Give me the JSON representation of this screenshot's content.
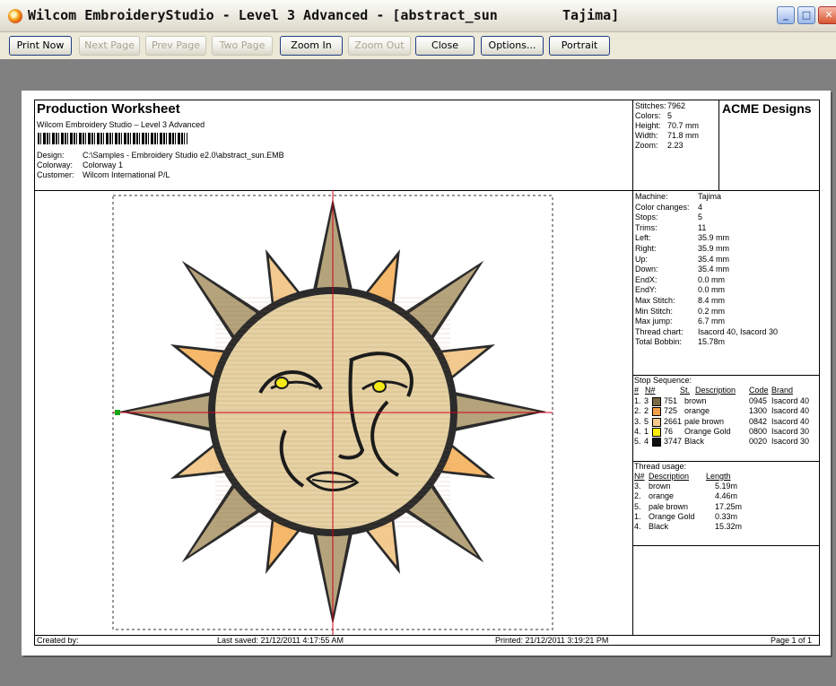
{
  "window": {
    "title": "Wilcom EmbroideryStudio - Level 3 Advanced - [abstract_sun        Tajima]"
  },
  "toolbar": {
    "buttons": [
      {
        "label": "Print Now",
        "enabled": true
      },
      {
        "label": "Next Page",
        "enabled": false
      },
      {
        "label": "Prev Page",
        "enabled": false
      },
      {
        "label": "Two Page",
        "enabled": false
      },
      {
        "label": "Zoom In",
        "enabled": true
      },
      {
        "label": "Zoom Out",
        "enabled": false
      },
      {
        "label": "Close",
        "enabled": true
      },
      {
        "label": "Options...",
        "enabled": true
      },
      {
        "label": "Portrait",
        "enabled": true
      }
    ]
  },
  "worksheet": {
    "title": "Production Worksheet",
    "subtitle": "Wilcom Embroidery Studio – Level 3 Advanced",
    "design_label": "Design:",
    "design_value": "C:\\Samples - Embroidery Studio e2.0\\abstract_sun.EMB",
    "colorway_label": "Colorway:",
    "colorway_value": "Colorway 1",
    "customer_label": "Customer:",
    "customer_value": "Wilcom International P/L",
    "company": "ACME Designs",
    "summary": [
      {
        "label": "Stitches:",
        "value": "7962"
      },
      {
        "label": "Colors:",
        "value": "5"
      },
      {
        "label": "Height:",
        "value": "70.7 mm"
      },
      {
        "label": "Width:",
        "value": "71.8 mm"
      },
      {
        "label": "Zoom:",
        "value": "2.23"
      }
    ],
    "machine_info": [
      {
        "label": "Machine:",
        "value": "Tajima"
      },
      {
        "label": "Color changes:",
        "value": "4"
      },
      {
        "label": "Stops:",
        "value": "5"
      },
      {
        "label": "Trims:",
        "value": "11"
      },
      {
        "label": "Left:",
        "value": "35.9 mm"
      },
      {
        "label": "Right:",
        "value": "35.9 mm"
      },
      {
        "label": "Up:",
        "value": "35.4 mm"
      },
      {
        "label": "Down:",
        "value": "35.4 mm"
      },
      {
        "label": "EndX:",
        "value": "0.0 mm"
      },
      {
        "label": "EndY:",
        "value": "0.0 mm"
      },
      {
        "label": "Max Stitch:",
        "value": "8.4 mm"
      },
      {
        "label": "Min Stitch:",
        "value": "0.2 mm"
      },
      {
        "label": "Max jump:",
        "value": "6.7 mm"
      },
      {
        "label": "Thread chart:",
        "value": "Isacord 40, Isacord 30"
      },
      {
        "label": "Total Bobbin:",
        "value": "15.78m"
      }
    ],
    "stop_sequence": {
      "heading": "Stop Sequence:",
      "headers": [
        "#",
        "N#",
        "St.",
        "Description",
        "Code",
        "Brand"
      ],
      "rows": [
        {
          "idx": "1.",
          "n": "3",
          "color": "#7a6a47",
          "st": "751",
          "desc": "brown",
          "code": "0945",
          "brand": "Isacord 40"
        },
        {
          "idx": "2.",
          "n": "2",
          "color": "#f0a04a",
          "st": "725",
          "desc": "orange",
          "code": "1300",
          "brand": "Isacord 40"
        },
        {
          "idx": "3.",
          "n": "5",
          "color": "#f6c98c",
          "st": "2661",
          "desc": "pale brown",
          "code": "0842",
          "brand": "Isacord 40"
        },
        {
          "idx": "4.",
          "n": "1",
          "color": "#ffee00",
          "st": "76",
          "desc": "Orange Gold",
          "code": "0800",
          "brand": "Isacord 30"
        },
        {
          "idx": "5.",
          "n": "4",
          "color": "#111111",
          "st": "3747",
          "desc": "Black",
          "code": "0020",
          "brand": "Isacord 30"
        }
      ]
    },
    "thread_usage": {
      "heading": "Thread usage:",
      "headers": [
        "N#",
        "Description",
        "Length"
      ],
      "rows": [
        {
          "n": "3.",
          "desc": "brown",
          "len": "5.19m"
        },
        {
          "n": "2.",
          "desc": "orange",
          "len": "4.46m"
        },
        {
          "n": "5.",
          "desc": "pale brown",
          "len": "17.25m"
        },
        {
          "n": "1.",
          "desc": "Orange Gold",
          "len": "0.33m"
        },
        {
          "n": "4.",
          "desc": "Black",
          "len": "15.32m"
        }
      ]
    },
    "footer": {
      "created": "Created by:",
      "saved": "Last saved: 21/12/2011 4:17:55 AM",
      "printed": "Printed: 21/12/2011 3:19:21 PM",
      "page": "Page 1 of 1"
    }
  },
  "colors": {
    "titlebar": "#ece9d8",
    "preview_bg": "#808080",
    "sun_light": "#e9d4a6",
    "sun_tan": "#b5a37c",
    "sun_orange": "#f6b86a",
    "outline": "#2b2b2b",
    "guide": "#d0021b"
  }
}
